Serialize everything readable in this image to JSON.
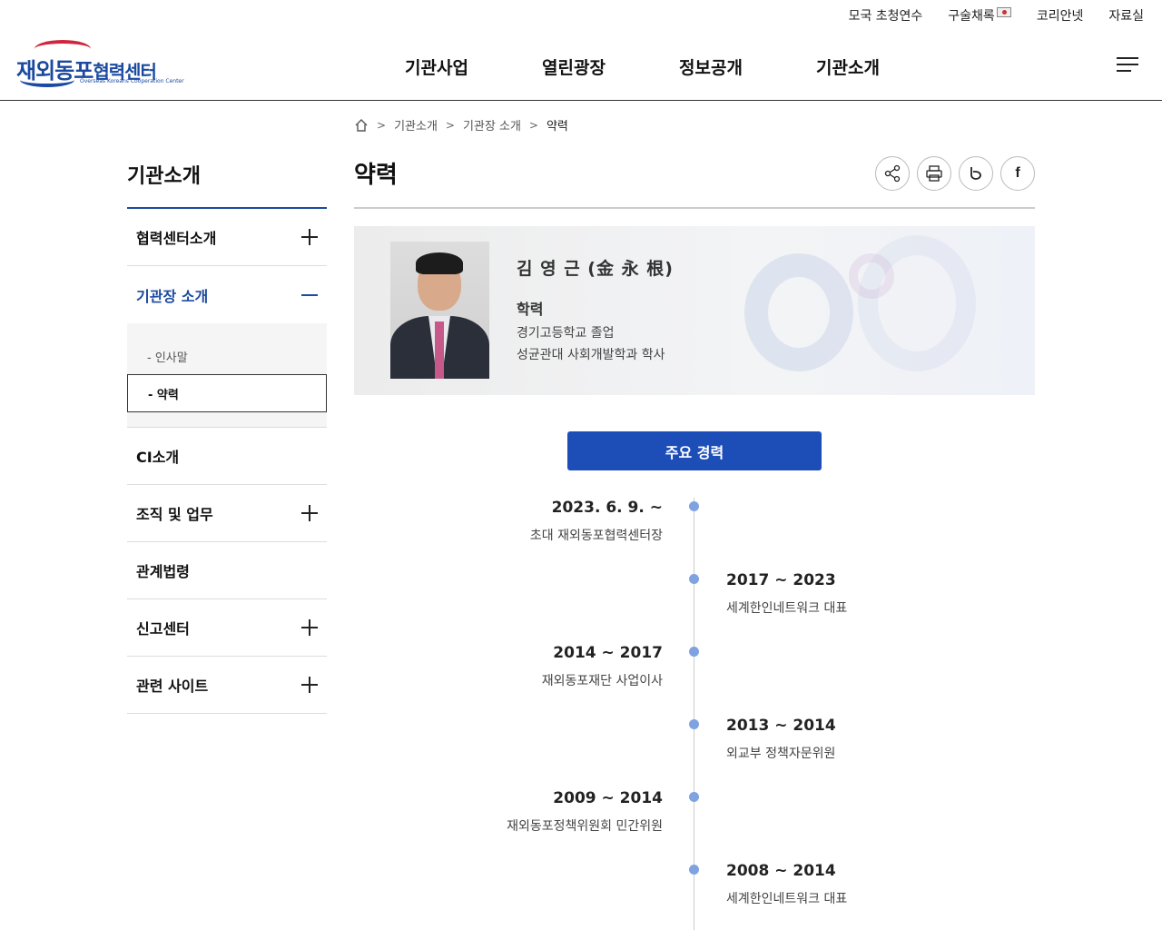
{
  "util_nav": [
    "모국 초청연수",
    "구술채록",
    "코리안넷",
    "자료실"
  ],
  "logo": {
    "main_blue": "재외동포",
    "main_blue2": "협력센터",
    "sub": "Overseas Koreans Cooperation Center"
  },
  "gnb": [
    "기관사업",
    "열린광장",
    "정보공개",
    "기관소개"
  ],
  "breadcrumb": [
    "기관소개",
    "기관장 소개",
    "약력"
  ],
  "sidebar": {
    "title": "기관소개",
    "items": [
      {
        "label": "협력센터소개",
        "toggle": "plus"
      },
      {
        "label": "기관장 소개",
        "toggle": "minus"
      },
      {
        "label": "CI소개",
        "toggle": "none"
      },
      {
        "label": "조직 및 업무",
        "toggle": "plus"
      },
      {
        "label": "관계법령",
        "toggle": "none"
      },
      {
        "label": "신고센터",
        "toggle": "plus"
      },
      {
        "label": "관련 사이트",
        "toggle": "plus"
      }
    ],
    "sub_items": [
      "- 인사말",
      "- 약력"
    ]
  },
  "page": {
    "title": "약력"
  },
  "share_tools": [
    "share-icon",
    "print-icon",
    "blog-icon",
    "facebook-icon"
  ],
  "profile": {
    "name": "김 영 근 (金 永 根)",
    "education_label": "학력",
    "education": [
      "경기고등학교 졸업",
      "성균관대 사회개발학과 학사"
    ]
  },
  "career_button": "주요 경력",
  "timeline": [
    {
      "period": "2023. 6. 9. ~",
      "desc": "초대 재외동포협력센터장",
      "side": "left"
    },
    {
      "period": "2017 ~ 2023",
      "desc": "세계한인네트워크 대표",
      "side": "right"
    },
    {
      "period": "2014 ~ 2017",
      "desc": "재외동포재단 사업이사",
      "side": "left"
    },
    {
      "period": "2013 ~ 2014",
      "desc": "외교부 정책자문위원",
      "side": "right"
    },
    {
      "period": "2009 ~ 2014",
      "desc": "재외동포정책위원회 민간위원",
      "side": "left"
    },
    {
      "period": "2008 ~ 2014",
      "desc": "세계한인네트워크 대표",
      "side": "right"
    }
  ],
  "colors": {
    "primary": "#1d4eb8",
    "brand_red": "#d0253a",
    "timeline_dot": "#7fa2e0"
  }
}
